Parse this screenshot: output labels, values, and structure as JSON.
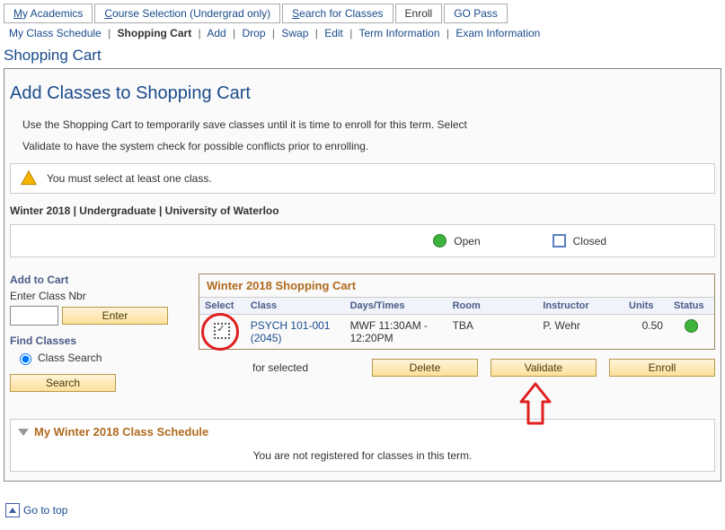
{
  "top_tabs": {
    "my_academics_prefix": "M",
    "my_academics_rest": "y Academics",
    "course_sel_prefix": "C",
    "course_sel_rest": "ourse Selection (Undergrad only)",
    "search_prefix": "S",
    "search_rest": "earch for Classes",
    "enroll": "Enroll",
    "go_pass": "GO Pass"
  },
  "sub_nav": {
    "my_class_schedule": "My Class Schedule",
    "shopping_cart": "Shopping Cart",
    "add": "Add",
    "drop": "Drop",
    "swap": "Swap",
    "edit": "Edit",
    "term_info": "Term Information",
    "exam_info": "Exam Information"
  },
  "titles": {
    "page_title": "Shopping Cart",
    "section_title": "Add Classes to Shopping Cart"
  },
  "desc": {
    "line1": "Use the Shopping Cart to temporarily save classes until it is time to enroll for this term.  Select",
    "line2": "Validate to have the system check for possible conflicts prior to enrolling."
  },
  "warning": "You must select at least one class.",
  "term_line": "Winter 2018 | Undergraduate | University of Waterloo",
  "legend": {
    "open": "Open",
    "closed": "Closed"
  },
  "left": {
    "add_to_cart": "Add to Cart",
    "enter_class_nbr": "Enter Class Nbr",
    "enter_btn": "Enter",
    "find_classes": "Find Classes",
    "class_search": "Class Search",
    "search_btn": "Search"
  },
  "cart": {
    "title": "Winter 2018 Shopping Cart",
    "headers": {
      "select": "Select",
      "class": "Class",
      "days_times": "Days/Times",
      "room": "Room",
      "instructor": "Instructor",
      "units": "Units",
      "status": "Status"
    },
    "rows": [
      {
        "class": "PSYCH 101-001 (2045)",
        "days_times": "MWF 11:30AM - 12:20PM",
        "room": "TBA",
        "instructor": "P. Wehr",
        "units": "0.50"
      }
    ],
    "for_selected": "for selected",
    "delete_btn": "Delete",
    "validate_btn": "Validate",
    "enroll_btn": "Enroll"
  },
  "schedule": {
    "title": "My Winter 2018 Class Schedule",
    "msg": "You are not registered for classes in this term."
  },
  "go_top": "Go to top"
}
